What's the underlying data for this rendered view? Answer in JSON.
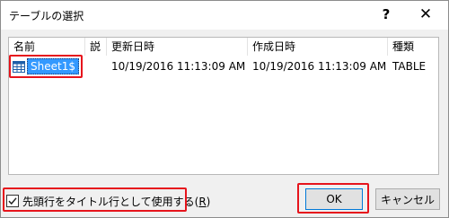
{
  "dialog": {
    "title": "テーブルの選択",
    "help_label": "?",
    "close_label": "✕"
  },
  "table": {
    "columns": [
      "名前",
      "説",
      "更新日時",
      "作成日時",
      "種類"
    ],
    "rows": [
      {
        "name": "Sheet1$",
        "description": "",
        "modified": "10/19/2016 11:13:09 AM",
        "created": "10/19/2016 11:13:09 AM",
        "type": "TABLE"
      }
    ]
  },
  "options": {
    "first_row_header_label": "先頭行をタイトル行として使用する(",
    "first_row_header_key": "R",
    "first_row_header_suffix": ")",
    "first_row_header_checked": true
  },
  "buttons": {
    "ok_label": "OK",
    "cancel_label": "キャンセル"
  },
  "icons": {
    "table": "table-grid-icon",
    "checkmark": "checkmark-icon"
  },
  "colors": {
    "selection": "#3399ff",
    "highlight_box": "#e6141c"
  }
}
